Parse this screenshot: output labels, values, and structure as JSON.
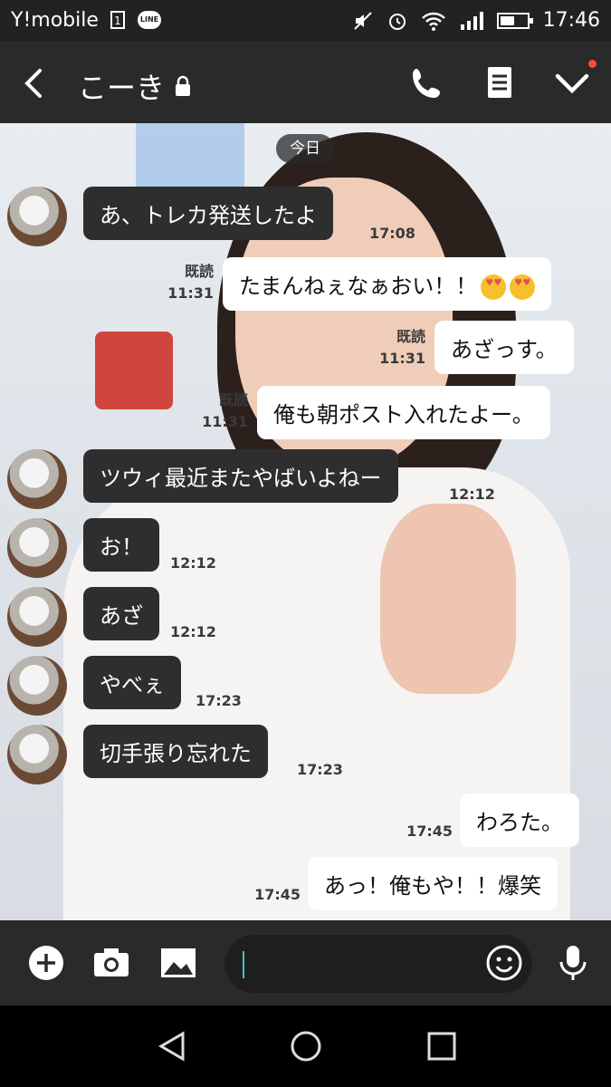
{
  "status_bar": {
    "carrier": "Y!mobile",
    "sim_label": "1",
    "line_label": "LINE",
    "time": "17:46",
    "battery_level": 0.6
  },
  "header": {
    "title": "こーき",
    "icons": [
      "back-icon",
      "lock-icon",
      "phone-icon",
      "notes-icon",
      "chevron-down-icon"
    ]
  },
  "date_pill": "今日",
  "messages": [
    {
      "side": "left",
      "text": "あ、トレカ発送したよ",
      "time": "17:08"
    },
    {
      "side": "right",
      "text": "たまんねぇなぁおい！！",
      "read": "既読",
      "time": "11:31",
      "emoji": "heart-eyes-emoji"
    },
    {
      "side": "right",
      "text": "あざっす。",
      "read": "既読",
      "time": "11:31"
    },
    {
      "side": "right",
      "text": "俺も朝ポスト入れたよー。",
      "read": "既読",
      "time": "11:31"
    },
    {
      "side": "left",
      "text": "ツウィ最近またやばいよねー",
      "time": "12:12"
    },
    {
      "side": "left",
      "text": "お！",
      "time": "12:12"
    },
    {
      "side": "left",
      "text": "あざ",
      "time": "12:12"
    },
    {
      "side": "left",
      "text": "やべぇ",
      "time": "17:23"
    },
    {
      "side": "left",
      "text": "切手張り忘れた",
      "time": "17:23"
    },
    {
      "side": "right",
      "text": "わろた。",
      "time": "17:45"
    },
    {
      "side": "right",
      "text": "あっ！俺もや！！爆笑",
      "time": "17:45"
    }
  ],
  "input_bar": {
    "icons": [
      "plus-icon",
      "camera-icon",
      "image-icon",
      "emoji-icon",
      "mic-icon"
    ],
    "value": ""
  },
  "nav_bar": {
    "icons": [
      "back-triangle-icon",
      "home-circle-icon",
      "recents-square-icon"
    ]
  },
  "colors": {
    "header": "#2a2a2a",
    "bubble_left": "#2e2e2e",
    "bubble_right": "#ffffff",
    "caret": "#3ec6c4",
    "notification_dot": "#ff4b3a"
  }
}
